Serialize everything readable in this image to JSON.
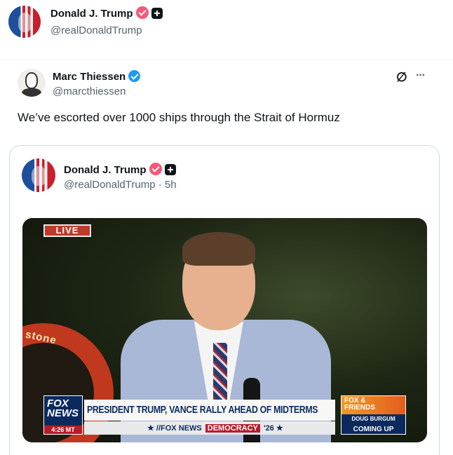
{
  "outer_author": {
    "name": "Donald J. Trump",
    "handle": "@realDonaldTrump"
  },
  "reply_tweet": {
    "author_name": "Marc Thiessen",
    "author_handle": "@marcthiessen",
    "text": "We’ve escorted over 1000 ships through the Strait of Hormuz",
    "more_icon": "···",
    "grok_icon": "∅"
  },
  "quoted_tweet": {
    "author_name": "Donald J. Trump",
    "author_handle": "@realDonaldTrump",
    "separator": "·",
    "time": "5h",
    "video": {
      "live_label": "LIVE",
      "tire_text": "stone",
      "network_logo": "FOX NEWS",
      "clock": "4:26 MT",
      "headline": "PRESIDENT TRUMP, VANCE RALLY AHEAD OF MIDTERMS",
      "ticker_prefix": "★ //FOX NEWS",
      "ticker_highlight": "DEMOCRACY",
      "ticker_suffix": "'26 ★",
      "promo_show": "FOX & FRIENDS",
      "promo_guest": "DOUG BURGUM",
      "promo_coming": "COMING UP"
    }
  },
  "colors": {
    "badge_red": "#f4587a",
    "badge_blue": "#1d9bf0",
    "handle_gray": "#536471"
  }
}
